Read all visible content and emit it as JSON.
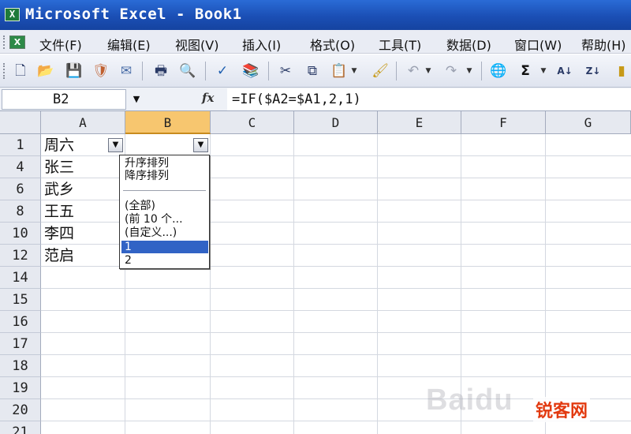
{
  "window": {
    "title": "Microsoft Excel - Book1"
  },
  "menu": [
    "文件(F)",
    "编辑(E)",
    "视图(V)",
    "插入(I)",
    "格式(O)",
    "工具(T)",
    "数据(D)",
    "窗口(W)",
    "帮助(H)"
  ],
  "toolbar_icons": [
    "new-icon",
    "open-icon",
    "save-icon",
    "permission-icon",
    "email-icon",
    "print-icon",
    "print-preview-icon",
    "spelling-icon",
    "research-icon",
    "cut-icon",
    "copy-icon",
    "paste-icon",
    "format-painter-icon",
    "undo-icon",
    "redo-icon",
    "hyperlink-icon",
    "autosum-icon",
    "sort-ascending-icon",
    "sort-descending-icon"
  ],
  "formula_bar": {
    "name_box": "B2",
    "fx": "fx",
    "formula": "=IF($A2=$A1,2,1)"
  },
  "columns": [
    "A",
    "B",
    "C",
    "D",
    "E",
    "F",
    "G"
  ],
  "selected_column": "B",
  "rows": [
    {
      "num": "1",
      "a": "周六"
    },
    {
      "num": "4",
      "a": "张三"
    },
    {
      "num": "6",
      "a": "武乡"
    },
    {
      "num": "8",
      "a": "王五"
    },
    {
      "num": "10",
      "a": "李四"
    },
    {
      "num": "12",
      "a": "范启"
    },
    {
      "num": "14",
      "a": ""
    },
    {
      "num": "15",
      "a": ""
    },
    {
      "num": "16",
      "a": ""
    },
    {
      "num": "17",
      "a": ""
    },
    {
      "num": "18",
      "a": ""
    },
    {
      "num": "19",
      "a": ""
    },
    {
      "num": "20",
      "a": ""
    },
    {
      "num": "21",
      "a": ""
    }
  ],
  "autofilter_dropdown": {
    "sort_asc": "升序排列",
    "sort_desc": "降序排列",
    "all": "(全部)",
    "top10": "(前 10 个...",
    "custom": "(自定义...)",
    "values": [
      "1",
      "2"
    ],
    "selected_value": "1"
  },
  "watermarks": {
    "baidu": "Baidu",
    "brand": "锐客网"
  }
}
